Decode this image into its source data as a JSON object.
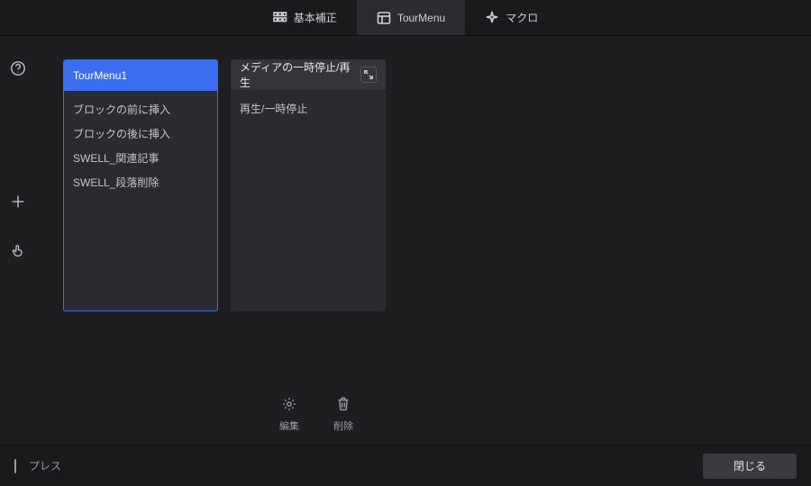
{
  "tabs": [
    {
      "label": "基本補正",
      "icon": "grid-icon"
    },
    {
      "label": "TourMenu",
      "icon": "layout-icon"
    },
    {
      "label": "マクロ",
      "icon": "sparkle-icon"
    }
  ],
  "active_tab_index": 1,
  "panels": [
    {
      "title": "TourMenu1",
      "selected": true,
      "items": [
        "ブロックの前に挿入",
        "ブロックの後に挿入",
        "SWELL_関連記事",
        "SWELL_段落削除"
      ]
    },
    {
      "title": "メディアの一時停止/再生",
      "selected": false,
      "header_icon": "expand-icon",
      "items": [
        "再生/一時停止"
      ]
    }
  ],
  "panel_actions": {
    "edit": "編集",
    "delete": "削除"
  },
  "footer": {
    "hint": "プレス",
    "close": "閉じる"
  }
}
